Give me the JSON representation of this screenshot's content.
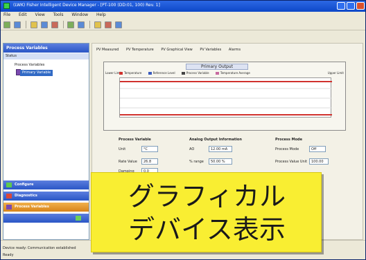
{
  "window": {
    "title": "(LWK) Fisher Intelligent Device Manager - [PT-100 (DD:01, 100) Rev. 1]"
  },
  "menu": [
    "File",
    "Edit",
    "View",
    "Tools",
    "Window",
    "Help"
  ],
  "left_pane": {
    "header": "Process Variables",
    "tree_top": "Status",
    "tree_device": "Process Variables",
    "tree_item": "Primary Variable",
    "buttons": [
      "Configure",
      "Diagnostics",
      "Process Variables"
    ]
  },
  "tabs": [
    "PV Measured",
    "PV Temperature",
    "PV Graphical View",
    "PV Variables",
    "Alarms"
  ],
  "chart": {
    "title": "Primary Output",
    "lower_label": "Lower Limit",
    "upper_label": "Upper Limit",
    "legend": [
      {
        "label": "Temperature",
        "color": "#d0312d"
      },
      {
        "label": "Reference Level",
        "color": "#3a5bbd"
      },
      {
        "label": "Process Variable",
        "color": "#444444"
      },
      {
        "label": "Temperature Average",
        "color": "#c76aa0"
      }
    ],
    "line_color": "#d0312d"
  },
  "sections": {
    "process_variable": {
      "title": "Process Variable",
      "fields": [
        {
          "label": "Unit",
          "value": "°C"
        },
        {
          "label": "Rate Value",
          "value": "26.8"
        },
        {
          "label": "Damping",
          "value": "0.0"
        }
      ]
    },
    "analog_output": {
      "title": "Analog Output Information",
      "fields": [
        {
          "label": "AO",
          "value": "12.00 mA"
        },
        {
          "label": "% range",
          "value": "50.00 %"
        }
      ]
    },
    "process_mode": {
      "title": "Process Mode",
      "fields": [
        {
          "label": "Process Mode",
          "value": "Off"
        },
        {
          "label": "Process Value Unit",
          "value": "100.00"
        }
      ]
    }
  },
  "status_bar": {
    "line1": "Device ready: Communication established",
    "line2": "Ready"
  },
  "overlay": {
    "line1": "グラフィカル",
    "line2": "デバイス表示"
  }
}
